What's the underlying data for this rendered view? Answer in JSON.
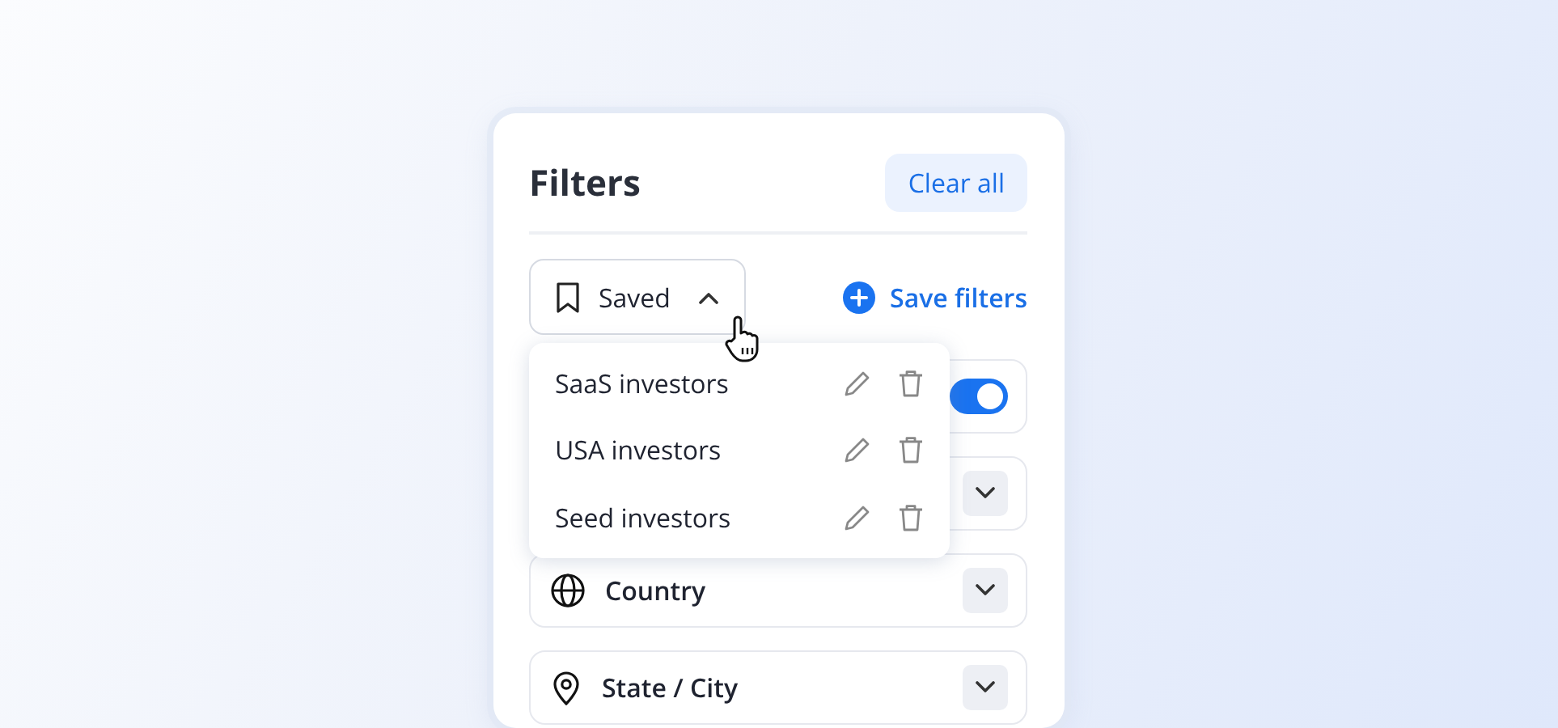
{
  "title": "Filters",
  "clear_button": "Clear all",
  "saved_menu": {
    "label": "Saved",
    "expanded": true,
    "items": [
      {
        "label": "SaaS investors"
      },
      {
        "label": "USA investors"
      },
      {
        "label": "Seed investors"
      }
    ]
  },
  "save_button": "Save filters",
  "filters": [
    {
      "kind": "toggle",
      "on": true
    },
    {
      "kind": "dropdown",
      "expanded": false
    },
    {
      "kind": "dropdown",
      "label": "Country",
      "expanded": false
    },
    {
      "kind": "dropdown",
      "label": "State / City",
      "expanded": false
    }
  ]
}
